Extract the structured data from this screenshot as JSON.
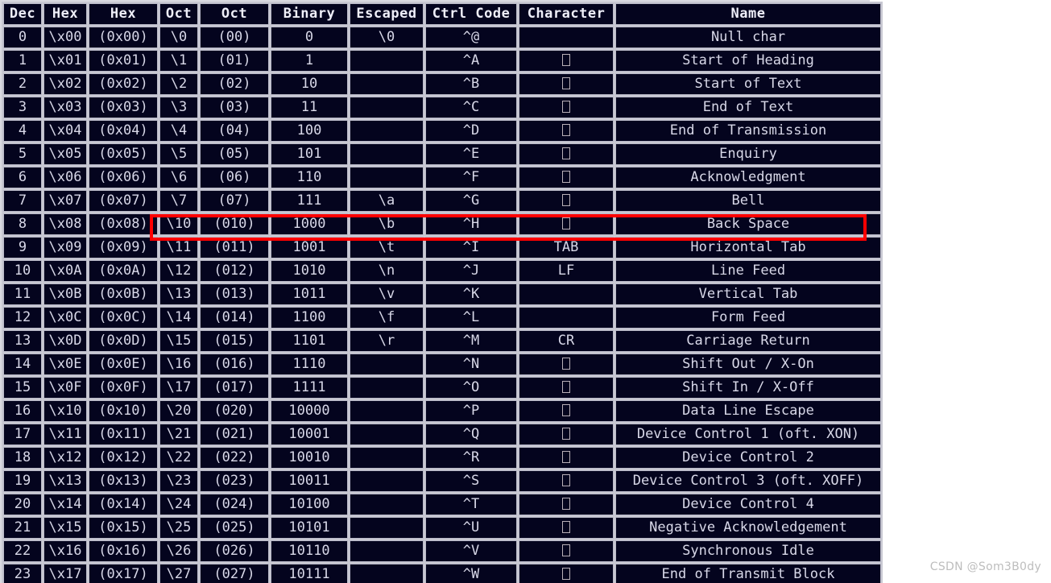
{
  "watermark": "CSDN @Som3B0dy",
  "colors": {
    "table_bg": "#04041e",
    "cell_border": "#b9b9c8",
    "text": "#d8d8e8",
    "page_bg": "#ffffff",
    "highlight": "#ff0000",
    "watermark": "#bdbdbd"
  },
  "table": {
    "columns": [
      "Dec",
      "Hex",
      "Hex",
      "Oct",
      "Oct",
      "Binary",
      "Escaped",
      "Ctrl Code",
      "Character",
      "Name"
    ],
    "highlighted_row_dec": "8",
    "rows": [
      {
        "dec": "0",
        "hex1": "\\x00",
        "hex2": "(0x00)",
        "oct1": "\\0",
        "oct2": "(00)",
        "bin": "0",
        "esc": "\\0",
        "ctrl": "^@",
        "chr": "",
        "name": "Null char"
      },
      {
        "dec": "1",
        "hex1": "\\x01",
        "hex2": "(0x01)",
        "oct1": "\\1",
        "oct2": "(01)",
        "bin": "1",
        "esc": "",
        "ctrl": "^A",
        "chr": "tofu",
        "name": "Start of Heading"
      },
      {
        "dec": "2",
        "hex1": "\\x02",
        "hex2": "(0x02)",
        "oct1": "\\2",
        "oct2": "(02)",
        "bin": "10",
        "esc": "",
        "ctrl": "^B",
        "chr": "tofu",
        "name": "Start of Text"
      },
      {
        "dec": "3",
        "hex1": "\\x03",
        "hex2": "(0x03)",
        "oct1": "\\3",
        "oct2": "(03)",
        "bin": "11",
        "esc": "",
        "ctrl": "^C",
        "chr": "tofu",
        "name": "End of Text"
      },
      {
        "dec": "4",
        "hex1": "\\x04",
        "hex2": "(0x04)",
        "oct1": "\\4",
        "oct2": "(04)",
        "bin": "100",
        "esc": "",
        "ctrl": "^D",
        "chr": "tofu",
        "name": "End of Transmission"
      },
      {
        "dec": "5",
        "hex1": "\\x05",
        "hex2": "(0x05)",
        "oct1": "\\5",
        "oct2": "(05)",
        "bin": "101",
        "esc": "",
        "ctrl": "^E",
        "chr": "tofu",
        "name": "Enquiry"
      },
      {
        "dec": "6",
        "hex1": "\\x06",
        "hex2": "(0x06)",
        "oct1": "\\6",
        "oct2": "(06)",
        "bin": "110",
        "esc": "",
        "ctrl": "^F",
        "chr": "tofu",
        "name": "Acknowledgment"
      },
      {
        "dec": "7",
        "hex1": "\\x07",
        "hex2": "(0x07)",
        "oct1": "\\7",
        "oct2": "(07)",
        "bin": "111",
        "esc": "\\a",
        "ctrl": "^G",
        "chr": "tofu",
        "name": "Bell"
      },
      {
        "dec": "8",
        "hex1": "\\x08",
        "hex2": "(0x08)",
        "oct1": "\\10",
        "oct2": "(010)",
        "bin": "1000",
        "esc": "\\b",
        "ctrl": "^H",
        "chr": "tofu",
        "name": "Back Space"
      },
      {
        "dec": "9",
        "hex1": "\\x09",
        "hex2": "(0x09)",
        "oct1": "\\11",
        "oct2": "(011)",
        "bin": "1001",
        "esc": "\\t",
        "ctrl": "^I",
        "chr": "TAB",
        "name": "Horizontal Tab"
      },
      {
        "dec": "10",
        "hex1": "\\x0A",
        "hex2": "(0x0A)",
        "oct1": "\\12",
        "oct2": "(012)",
        "bin": "1010",
        "esc": "\\n",
        "ctrl": "^J",
        "chr": "LF",
        "name": "Line Feed"
      },
      {
        "dec": "11",
        "hex1": "\\x0B",
        "hex2": "(0x0B)",
        "oct1": "\\13",
        "oct2": "(013)",
        "bin": "1011",
        "esc": "\\v",
        "ctrl": "^K",
        "chr": "",
        "name": "Vertical Tab"
      },
      {
        "dec": "12",
        "hex1": "\\x0C",
        "hex2": "(0x0C)",
        "oct1": "\\14",
        "oct2": "(014)",
        "bin": "1100",
        "esc": "\\f",
        "ctrl": "^L",
        "chr": "",
        "name": "Form Feed"
      },
      {
        "dec": "13",
        "hex1": "\\x0D",
        "hex2": "(0x0D)",
        "oct1": "\\15",
        "oct2": "(015)",
        "bin": "1101",
        "esc": "\\r",
        "ctrl": "^M",
        "chr": "CR",
        "name": "Carriage Return"
      },
      {
        "dec": "14",
        "hex1": "\\x0E",
        "hex2": "(0x0E)",
        "oct1": "\\16",
        "oct2": "(016)",
        "bin": "1110",
        "esc": "",
        "ctrl": "^N",
        "chr": "tofu",
        "name": "Shift Out / X-On"
      },
      {
        "dec": "15",
        "hex1": "\\x0F",
        "hex2": "(0x0F)",
        "oct1": "\\17",
        "oct2": "(017)",
        "bin": "1111",
        "esc": "",
        "ctrl": "^O",
        "chr": "tofu",
        "name": "Shift In / X-Off"
      },
      {
        "dec": "16",
        "hex1": "\\x10",
        "hex2": "(0x10)",
        "oct1": "\\20",
        "oct2": "(020)",
        "bin": "10000",
        "esc": "",
        "ctrl": "^P",
        "chr": "tofu",
        "name": "Data Line Escape"
      },
      {
        "dec": "17",
        "hex1": "\\x11",
        "hex2": "(0x11)",
        "oct1": "\\21",
        "oct2": "(021)",
        "bin": "10001",
        "esc": "",
        "ctrl": "^Q",
        "chr": "tofu",
        "name": "Device Control 1 (oft. XON)"
      },
      {
        "dec": "18",
        "hex1": "\\x12",
        "hex2": "(0x12)",
        "oct1": "\\22",
        "oct2": "(022)",
        "bin": "10010",
        "esc": "",
        "ctrl": "^R",
        "chr": "tofu",
        "name": "Device Control 2"
      },
      {
        "dec": "19",
        "hex1": "\\x13",
        "hex2": "(0x13)",
        "oct1": "\\23",
        "oct2": "(023)",
        "bin": "10011",
        "esc": "",
        "ctrl": "^S",
        "chr": "tofu",
        "name": "Device Control 3 (oft. XOFF)"
      },
      {
        "dec": "20",
        "hex1": "\\x14",
        "hex2": "(0x14)",
        "oct1": "\\24",
        "oct2": "(024)",
        "bin": "10100",
        "esc": "",
        "ctrl": "^T",
        "chr": "tofu",
        "name": "Device Control 4"
      },
      {
        "dec": "21",
        "hex1": "\\x15",
        "hex2": "(0x15)",
        "oct1": "\\25",
        "oct2": "(025)",
        "bin": "10101",
        "esc": "",
        "ctrl": "^U",
        "chr": "tofu",
        "name": "Negative Acknowledgement"
      },
      {
        "dec": "22",
        "hex1": "\\x16",
        "hex2": "(0x16)",
        "oct1": "\\26",
        "oct2": "(026)",
        "bin": "10110",
        "esc": "",
        "ctrl": "^V",
        "chr": "tofu",
        "name": "Synchronous Idle"
      },
      {
        "dec": "23",
        "hex1": "\\x17",
        "hex2": "(0x17)",
        "oct1": "\\27",
        "oct2": "(027)",
        "bin": "10111",
        "esc": "",
        "ctrl": "^W",
        "chr": "tofu",
        "name": "End of Transmit Block"
      }
    ]
  }
}
